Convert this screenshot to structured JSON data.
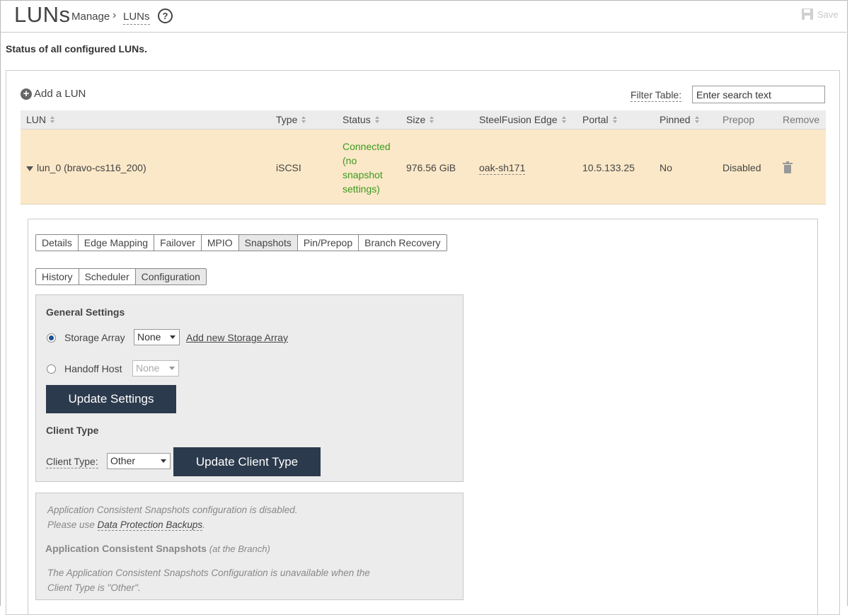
{
  "header": {
    "title": "LUNs",
    "breadcrumb": [
      "Manage",
      "LUNs"
    ],
    "breadcrumb_sep": "›",
    "help_icon": "?",
    "save_label": "Save"
  },
  "subtitle": "Status of all configured LUNs.",
  "toolbar": {
    "add_label": "Add a LUN",
    "filter_label": "Filter Table:",
    "filter_placeholder": "Enter search text"
  },
  "table": {
    "columns": [
      "LUN",
      "Type",
      "Status",
      "Size",
      "SteelFusion Edge",
      "Portal",
      "Pinned",
      "Prepop",
      "Remove"
    ],
    "rows": [
      {
        "lun": "lun_0 (bravo-cs116_200)",
        "type": "iSCSI",
        "status": [
          "Connected",
          "(no",
          "snapshot",
          "settings)"
        ],
        "size": "976.56 GiB",
        "edge": "oak-sh171",
        "portal": "10.5.133.25",
        "pinned": "No",
        "prepop": "Disabled"
      }
    ]
  },
  "detail": {
    "tabs": [
      "Details",
      "Edge Mapping",
      "Failover",
      "MPIO",
      "Snapshots",
      "Pin/Prepop",
      "Branch Recovery"
    ],
    "active_tab": "Snapshots",
    "subtabs": [
      "History",
      "Scheduler",
      "Configuration"
    ],
    "active_subtab": "Configuration",
    "general": {
      "heading": "General Settings",
      "storage_array_label": "Storage Array",
      "storage_array_value": "None",
      "add_array_link": "Add new Storage Array",
      "handoff_label": "Handoff Host",
      "handoff_value": "None",
      "update_btn": "Update Settings"
    },
    "client": {
      "heading": "Client Type",
      "label": "Client Type:",
      "value": "Other",
      "update_btn": "Update Client Type"
    },
    "app_consistent": {
      "disabled_line1": "Application Consistent Snapshots configuration is disabled.",
      "disabled_line2_prefix": "Please use ",
      "disabled_link": "Data Protection Backups",
      "disabled_line2_suffix": ".",
      "heading": "Application Consistent Snapshots",
      "heading_note": "(at the Branch)",
      "unavailable_line1": "The Application Consistent Snapshots Configuration is unavailable when the",
      "unavailable_line2": "Client Type is \"Other\"."
    }
  },
  "colors": {
    "row_highlight": "#fbe8c8",
    "status_connected": "#3a9b1e",
    "button_dark": "#2c3a4d"
  }
}
